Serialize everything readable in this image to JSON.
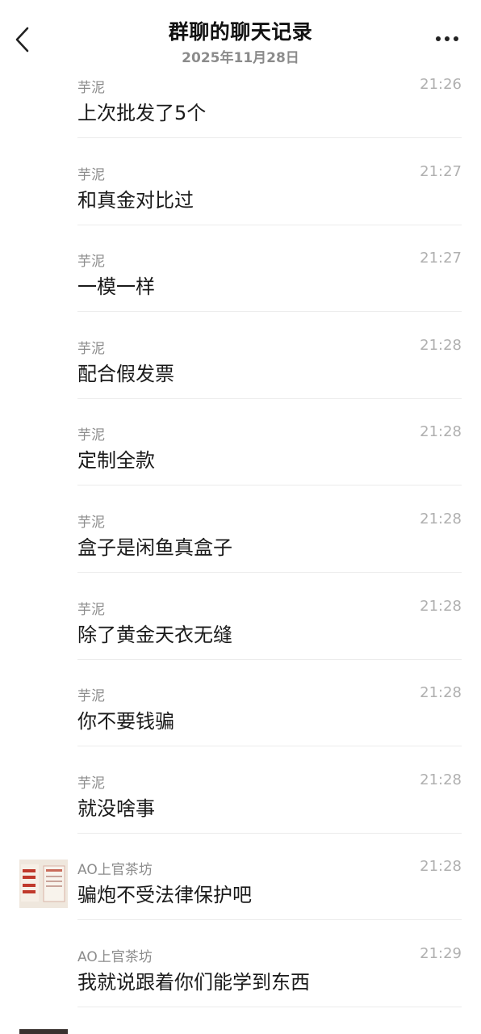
{
  "header": {
    "title": "群聊的聊天记录",
    "subtitle": "2025年11月28日",
    "back_icon": "chevron-left-icon",
    "more_icon": "more-horizontal-icon"
  },
  "messages": [
    {
      "sender": "芋泥",
      "time": "21:26",
      "text": "上次批发了5个",
      "avatar": false
    },
    {
      "sender": "芋泥",
      "time": "21:27",
      "text": "和真金对比过",
      "avatar": false
    },
    {
      "sender": "芋泥",
      "time": "21:27",
      "text": "一模一样",
      "avatar": false
    },
    {
      "sender": "芋泥",
      "time": "21:28",
      "text": "配合假发票",
      "avatar": false
    },
    {
      "sender": "芋泥",
      "time": "21:28",
      "text": "定制全款",
      "avatar": false
    },
    {
      "sender": "芋泥",
      "time": "21:28",
      "text": "盒子是闲鱼真盒子",
      "avatar": false
    },
    {
      "sender": "芋泥",
      "time": "21:28",
      "text": "除了黄金天衣无缝",
      "avatar": false
    },
    {
      "sender": "芋泥",
      "time": "21:28",
      "text": "你不要钱骗",
      "avatar": false
    },
    {
      "sender": "芋泥",
      "time": "21:28",
      "text": "就没啥事",
      "avatar": false
    },
    {
      "sender": "AO上官茶坊",
      "time": "21:28",
      "text": "骗炮不受法律保护吧",
      "avatar": true
    },
    {
      "sender": "AO上官茶坊",
      "time": "21:29",
      "text": "我就说跟着你们能学到东西",
      "avatar": false
    }
  ],
  "colors": {
    "title": "#111111",
    "secondary": "#8c8c8c",
    "time": "#b0b0b0",
    "divider": "#ececec"
  }
}
